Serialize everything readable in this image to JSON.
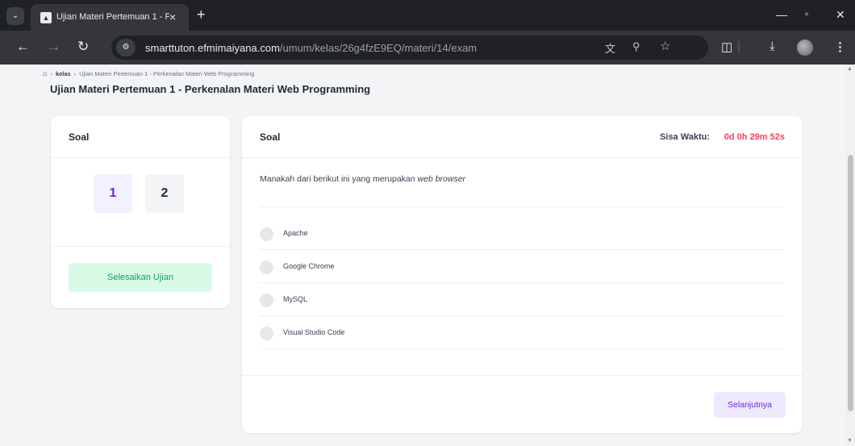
{
  "browser": {
    "tab_title": "Ujian Materi Pertemuan 1 - P",
    "url_host": "smarttuton.efmimaiyana.com",
    "url_path": "/umum/kelas/26g4fzE9EQ/materi/14/exam"
  },
  "breadcrumb": {
    "home_icon": "home-icon",
    "kelas": "kelas",
    "current": "Ujian Materi Pertemuan 1 - Perkenalan Materi Web Programming"
  },
  "page": {
    "title": "Ujian Materi Pertemuan 1 - Perkenalan Materi Web Programming"
  },
  "sidebar": {
    "header": "Soal",
    "questions": [
      "1",
      "2"
    ],
    "active_question": "1",
    "finish_label": "Selesaikan Ujian"
  },
  "main": {
    "header": "Soal",
    "timer_label": "Sisa Waktu:",
    "timer_value": "0d 0h 29m 52s",
    "question_text": "Manakah dari berikut ini yang merupakan",
    "question_emphasis": "web browser",
    "options": [
      "Apache",
      "Google Chrome",
      "MySQL",
      "Visual Studio Code"
    ],
    "next_label": "Selanjutnya"
  },
  "colors": {
    "accent": "#6d28d9",
    "success": "#16a34a",
    "timer": "#f43f5e"
  }
}
